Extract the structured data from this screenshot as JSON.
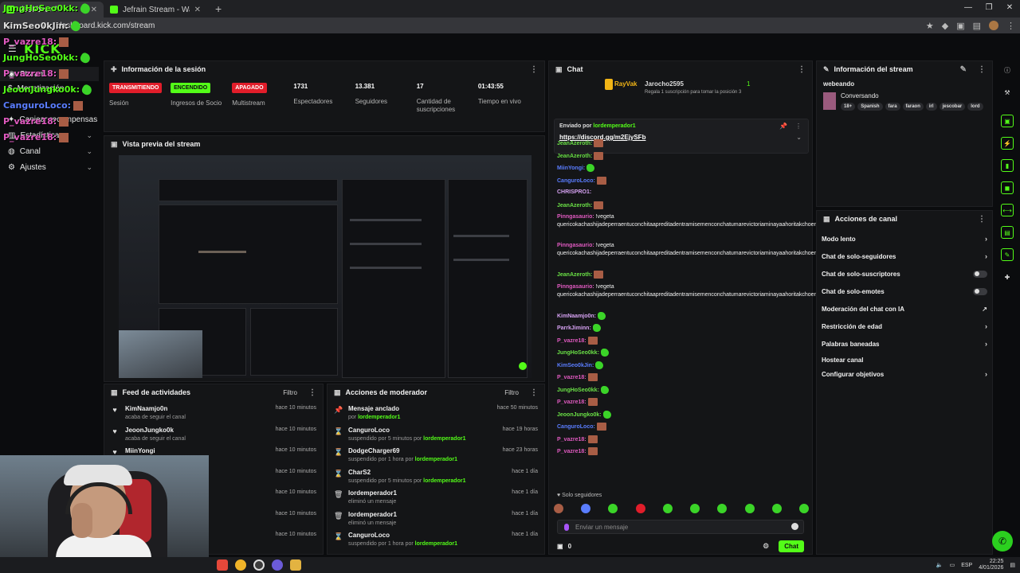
{
  "browser": {
    "tabs": [
      {
        "title": "dashboard"
      },
      {
        "title": "Jefrain Stream - Watch Live on"
      }
    ],
    "url": "dashboard.kick.com/stream"
  },
  "sitenav": {
    "logo": "KICK",
    "items": [
      {
        "label": "Stream",
        "icon": "broadcast-icon"
      },
      {
        "label": "Monetización",
        "icon": "money-icon"
      },
      {
        "label": "Canjear recompensas",
        "icon": "gift-icon"
      },
      {
        "label": "Estadísticas",
        "icon": "chart-icon"
      },
      {
        "label": "Canal",
        "icon": "user-icon"
      },
      {
        "label": "Ajustes",
        "icon": "gear-icon"
      }
    ]
  },
  "session": {
    "title": "Información de la sesión",
    "stats": [
      {
        "badge": "TRANSMITIENDO",
        "badge_color": "red",
        "label": "Sesión"
      },
      {
        "badge": "ENCENDIDO",
        "badge_color": "green",
        "label": "Ingresos de Socio"
      },
      {
        "badge": "APAGADO",
        "badge_color": "red",
        "label": "Multistream"
      },
      {
        "value": "1731",
        "label": "Espectadores"
      },
      {
        "value": "13.381",
        "label": "Seguidores"
      },
      {
        "value": "17",
        "label": "Cantidad de suscripciones"
      },
      {
        "value": "01:43:55",
        "label": "Tiempo en vivo"
      }
    ]
  },
  "preview": {
    "title": "Vista previa del stream"
  },
  "feed": {
    "title": "Feed de actividades",
    "filter": "Filtro",
    "items": [
      {
        "user": "KimNaamjo0n",
        "action": "acaba de seguir el canal",
        "time": "hace 10 minutos"
      },
      {
        "user": "JeoonJungko0k",
        "action": "acaba de seguir el canal",
        "time": "hace 10 minutos"
      },
      {
        "user": "MiinYongi",
        "action": "",
        "time": "hace 10 minutos"
      },
      {
        "user": "",
        "action": "",
        "time": "hace 10 minutos"
      },
      {
        "user": "",
        "action": "",
        "time": "hace 10 minutos"
      },
      {
        "user": "",
        "action": "",
        "time": "hace 10 minutos"
      },
      {
        "user": "",
        "action": "",
        "time": "hace 10 minutos"
      }
    ]
  },
  "modactions": {
    "title": "Acciones de moderador",
    "filter": "Filtro",
    "items": [
      {
        "icon": "pin-icon",
        "title": "Mensaje anclado",
        "pre": "por ",
        "hl": "lordemperador1",
        "post": "",
        "time": "hace 50 minutos"
      },
      {
        "icon": "hourglass-icon",
        "title": "CanguroLoco",
        "pre": "suspendido por 5 minutos por ",
        "hl": "lordemperador1",
        "post": "",
        "time": "hace 19 horas"
      },
      {
        "icon": "hourglass-icon",
        "title": "DodgeCharger69",
        "pre": "suspendido por 1 hora por ",
        "hl": "lordemperador1",
        "post": "",
        "time": "hace 23 horas"
      },
      {
        "icon": "hourglass-icon",
        "title": "CharS2",
        "pre": "suspendido por 5 minutos por ",
        "hl": "lordemperador1",
        "post": "",
        "time": "hace 1 día"
      },
      {
        "icon": "trash-icon",
        "title": "lordemperador1",
        "pre": "eliminó un mensaje",
        "hl": "",
        "post": "",
        "time": "hace 1 día"
      },
      {
        "icon": "trash-icon",
        "title": "lordemperador1",
        "pre": "eliminó un mensaje",
        "hl": "",
        "post": "",
        "time": "hace 1 día"
      },
      {
        "icon": "hourglass-icon",
        "title": "CanguroLoco",
        "pre": "suspendido por 1 hora por ",
        "hl": "lordemperador1",
        "post": "",
        "time": "hace 1 día"
      }
    ]
  },
  "chat": {
    "title": "Chat",
    "gift": {
      "user1": "RayVak",
      "user2": "Jarocho2595",
      "count": "1",
      "text": "Regala 1 suscripción para tomar la posición 3"
    },
    "pinned": {
      "label": "Enviado por",
      "user": "lordemperador1",
      "link": "https://discord.gg/m2EjySFb"
    },
    "messages": [
      {
        "user": "JeanAzeroth:",
        "color": "c-green",
        "text": "",
        "emote": "brown"
      },
      {
        "user": "JeanAzeroth:",
        "color": "c-green",
        "text": "",
        "emote": "brown"
      },
      {
        "user": "MiinYongi:",
        "color": "c-blue",
        "text": "",
        "emote": "green"
      },
      {
        "user": "CanguroLoco:",
        "color": "c-blue",
        "text": "",
        "emote": "brown"
      },
      {
        "user": "CHRISPRO1:",
        "color": "c-purple",
        "text": "",
        "emote": ""
      },
      {
        "user": "JeanAzeroth:",
        "color": "c-green",
        "text": "",
        "emote": "brown"
      },
      {
        "user": "Pinngasaurio:",
        "color": "c-pink",
        "text": "!vegeta quericokachashijadeperraentuconchitaapreditadentramisemenconchatumarevictoriaminayaahoritakchoentuvaginadeperra",
        "emote": ""
      },
      {
        "user": "Pinngasaurio:",
        "color": "c-pink",
        "text": "!vegeta quericokachashijadeperraentuconchitaapreditadentramisemenconchatumarevictoriaminayaahoritakchoentuvaginadeperra",
        "emote": ""
      },
      {
        "user": "JeanAzeroth:",
        "color": "c-green",
        "text": "",
        "emote": "brown"
      },
      {
        "user": "Pinngasaurio:",
        "color": "c-pink",
        "text": "!vegeta quericokachashijadeperraentuconchitaapreditadentramisemenconchatumarevictoriaminayaahoritakchoentuvaginadeperra",
        "emote": ""
      },
      {
        "user": "KimNaamjo0n:",
        "color": "c-purple",
        "text": "",
        "emote": "green"
      },
      {
        "user": "ParrkJiminn:",
        "color": "c-purple",
        "text": "",
        "emote": "green"
      },
      {
        "user": "P_vazre18:",
        "color": "c-pink",
        "text": "",
        "emote": "brown"
      },
      {
        "user": "JungHoSeo0kk:",
        "color": "c-green",
        "text": "",
        "emote": "green"
      },
      {
        "user": "KimSeo0kJin:",
        "color": "c-blue",
        "text": "",
        "emote": "green"
      },
      {
        "user": "P_vazre18:",
        "color": "c-pink",
        "text": "",
        "emote": "brown"
      },
      {
        "user": "JungHoSeo0kk:",
        "color": "c-green",
        "text": "",
        "emote": "green"
      },
      {
        "user": "P_vazre18:",
        "color": "c-pink",
        "text": "",
        "emote": "brown"
      },
      {
        "user": "JeoonJungko0k:",
        "color": "c-green",
        "text": "",
        "emote": "green"
      },
      {
        "user": "CanguroLoco:",
        "color": "c-blue",
        "text": "",
        "emote": "brown"
      },
      {
        "user": "P_vazre18:",
        "color": "c-pink",
        "text": "",
        "emote": "brown"
      },
      {
        "user": "P_vazre18:",
        "color": "c-pink",
        "text": "",
        "emote": "brown"
      }
    ],
    "mode": "Solo seguidores",
    "input_placeholder": "Enviar un mensaje",
    "count": "0",
    "send_label": "Chat"
  },
  "streaminfo": {
    "title": "Información del stream",
    "stream_title": "webeando",
    "category": "Conversando",
    "tags": [
      "18+",
      "Spanish",
      "fara",
      "faraon",
      "irl",
      "jescobar",
      "lord"
    ]
  },
  "channelactions": {
    "title": "Acciones de canal",
    "items": [
      {
        "label": "Modo lento",
        "control": "chevron"
      },
      {
        "label": "Chat de solo-seguidores",
        "control": "chevron"
      },
      {
        "label": "Chat de solo-suscriptores",
        "control": "toggle"
      },
      {
        "label": "Chat de solo-emotes",
        "control": "toggle"
      },
      {
        "label": "Moderación del chat con IA",
        "control": "external"
      },
      {
        "label": "Restricción de edad",
        "control": "chevron"
      },
      {
        "label": "Palabras baneadas",
        "control": "chevron"
      },
      {
        "label": "Hostear canal",
        "control": "none"
      },
      {
        "label": "Configurar objetivos",
        "control": "chevron"
      }
    ]
  },
  "overlay_chat": [
    {
      "name": "JungHoSeo0kk:",
      "color": "#53fc18",
      "emote": "green"
    },
    {
      "name": "KimSeo0kJin:",
      "color": "#dcdcdc",
      "emote": "green"
    },
    {
      "name": "P_vazre18:",
      "color": "#e05ac0",
      "emote": "brown"
    },
    {
      "name": "JungHoSeo0kk:",
      "color": "#53fc18",
      "emote": "green"
    },
    {
      "name": "P_vazre18:",
      "color": "#e05ac0",
      "emote": "brown"
    },
    {
      "name": "JeoonJungko0k:",
      "color": "#53fc18",
      "emote": "green"
    },
    {
      "name": "CanguroLoco:",
      "color": "#5a7dff",
      "emote": "brown"
    },
    {
      "name": "P_vazre18:",
      "color": "#e05ac0",
      "emote": "brown"
    },
    {
      "name": "P_vazre18:",
      "color": "#e05ac0",
      "emote": "brown"
    }
  ],
  "taskbar": {
    "lang": "ESP",
    "time": "22:25",
    "date": "4/01/2026"
  }
}
